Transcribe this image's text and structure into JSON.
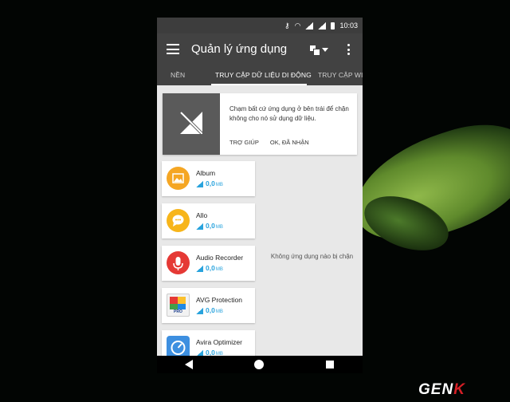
{
  "status_bar": {
    "time": "10:03",
    "icons": [
      "key-icon",
      "wifi-icon",
      "signal-icon",
      "signal-icon",
      "battery-icon"
    ]
  },
  "app_bar": {
    "title": "Quản lý ứng dụng",
    "icons": [
      "menu-icon",
      "filter-icon",
      "overflow-menu-icon"
    ]
  },
  "tabs": [
    {
      "label": "NỀN",
      "active": false
    },
    {
      "label": "TRUY CẬP DỮ LIỆU DI ĐỘNG",
      "active": true
    },
    {
      "label": "TRUY CẬP WI-FI",
      "active": false
    }
  ],
  "info_card": {
    "text": "Chạm bất cứ ứng dụng ở bên trái để chặn không cho nó sử dụng dữ liệu.",
    "help_button": "TRỢ GIÚP",
    "ok_button": "OK, ĐÃ NHẬN"
  },
  "apps": [
    {
      "name": "Album",
      "data": "0,0",
      "unit": "MB",
      "icon": "album-icon",
      "color": "#f5a623"
    },
    {
      "name": "Allo",
      "data": "0,0",
      "unit": "MB",
      "icon": "allo-icon",
      "color": "#f7b51a"
    },
    {
      "name": "Audio Recorder",
      "data": "0,0",
      "unit": "MB",
      "icon": "microphone-icon",
      "color": "#e53935"
    },
    {
      "name": "AVG Protection",
      "data": "0,0",
      "unit": "MB",
      "icon": "avg-icon",
      "color": "#2e7bd1",
      "badge": "PRO"
    },
    {
      "name": "Avira Optimizer",
      "data": "0,0",
      "unit": "MB",
      "icon": "avira-icon",
      "color": "#3d8fe0"
    }
  ],
  "blocked_panel": {
    "empty_text": "Không ứng dụng nào bị chặn"
  },
  "nav_bar": {
    "icons": [
      "back-icon",
      "home-icon",
      "recents-icon"
    ]
  },
  "watermark": {
    "text_main": "GEN",
    "text_highlight": "K"
  },
  "colors": {
    "app_bar": "#424242",
    "accent": "#29a3dd",
    "content_bg": "#e8e8e8"
  }
}
